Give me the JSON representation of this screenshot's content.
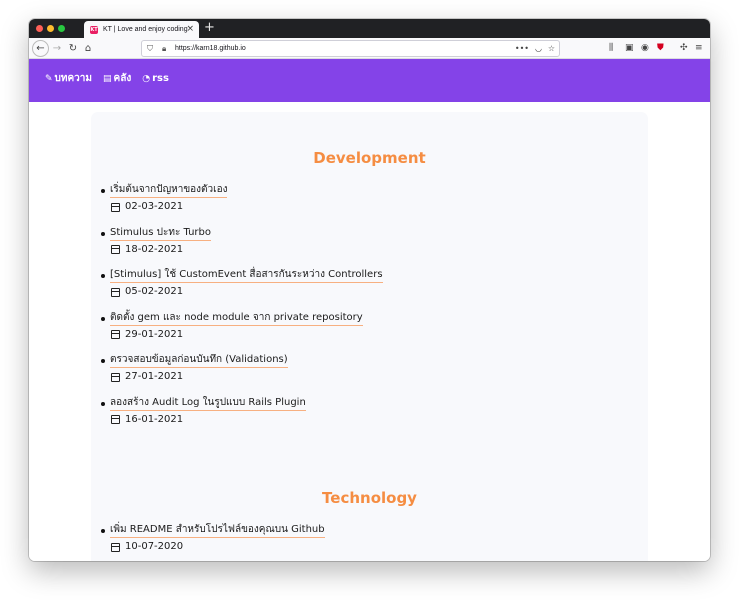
{
  "browser": {
    "tab_title": "KT | Love and enjoy coding",
    "tab_favicon": "KT",
    "url": "https://karn18.github.io"
  },
  "site": {
    "nav": [
      {
        "icon": "pencil-icon",
        "label": "บทความ"
      },
      {
        "icon": "archive-icon",
        "label": "คลัง"
      },
      {
        "icon": "rss-icon",
        "label": "rss"
      }
    ],
    "header_color": "#8443e8",
    "accent_color": "#f58d42"
  },
  "sections": [
    {
      "title": "Development",
      "posts": [
        {
          "title": "เริ่มต้นจากปัญหาของตัวเอง",
          "date": "02-03-2021"
        },
        {
          "title": "Stimulus ปะทะ Turbo",
          "date": "18-02-2021"
        },
        {
          "title": "[Stimulus] ใช้ CustomEvent สื่อสารกันระหว่าง Controllers",
          "date": "05-02-2021"
        },
        {
          "title": "ติดตั้ง gem และ node module จาก private repository",
          "date": "29-01-2021"
        },
        {
          "title": "ตรวจสอบข้อมูลก่อนบันทึก (Validations)",
          "date": "27-01-2021"
        },
        {
          "title": "ลองสร้าง Audit Log ในรูปแบบ Rails Plugin",
          "date": "16-01-2021"
        }
      ]
    },
    {
      "title": "Technology",
      "posts": [
        {
          "title": "เพิ่ม README สำหรับโปรไฟล์ของคุณบน Github",
          "date": "10-07-2020"
        }
      ]
    }
  ]
}
